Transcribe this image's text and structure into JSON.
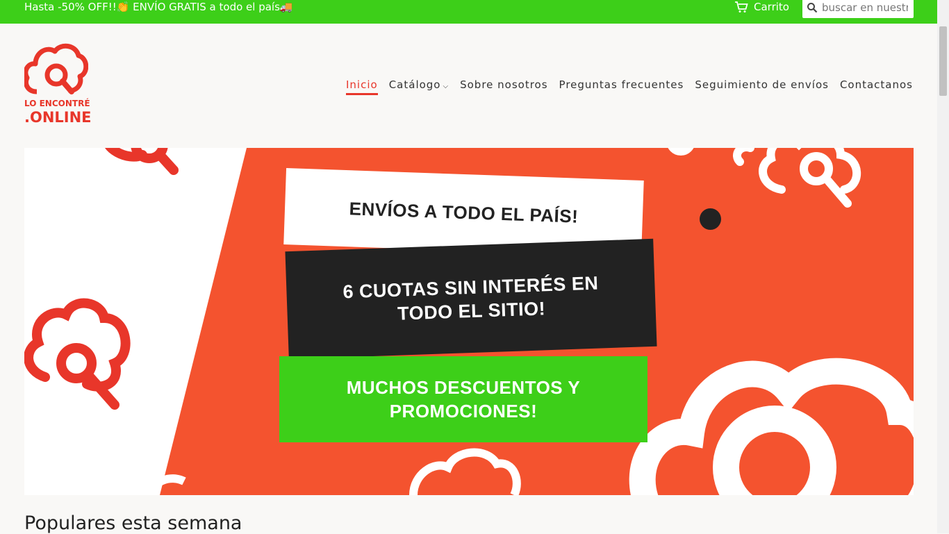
{
  "announcement": {
    "text": "Hasta -50% OFF!!👏 ENVÍO GRATIS a todo el país🚚"
  },
  "header": {
    "cart_label": "Carrito",
    "search_placeholder": "buscar en nuestra tienda"
  },
  "logo": {
    "line1": "LO ENCONTRÉ",
    "line2": ".ONLINE"
  },
  "nav": {
    "items": [
      {
        "label": "Inicio",
        "active": true
      },
      {
        "label": "Catálogo",
        "has_dropdown": true
      },
      {
        "label": "Sobre nosotros"
      },
      {
        "label": "Preguntas frecuentes"
      },
      {
        "label": "Seguimiento de envíos"
      },
      {
        "label": "Contactanos"
      }
    ]
  },
  "hero": {
    "card1": "ENVÍOS A TODO EL PAÍS!",
    "card2": "6 CUOTAS SIN INTERÉS EN TODO EL SITIO!",
    "card3": "MUCHOS DESCUENTOS Y PROMOCIONES!"
  },
  "sections": {
    "popular_title": "Populares esta semana"
  },
  "colors": {
    "brand_green": "#3dcf19",
    "brand_red": "#e8362a",
    "hero_orange": "#f4532f"
  },
  "icons": {
    "cart": "cart-icon",
    "search": "search-icon",
    "dropdown": "chevron-down-icon"
  }
}
